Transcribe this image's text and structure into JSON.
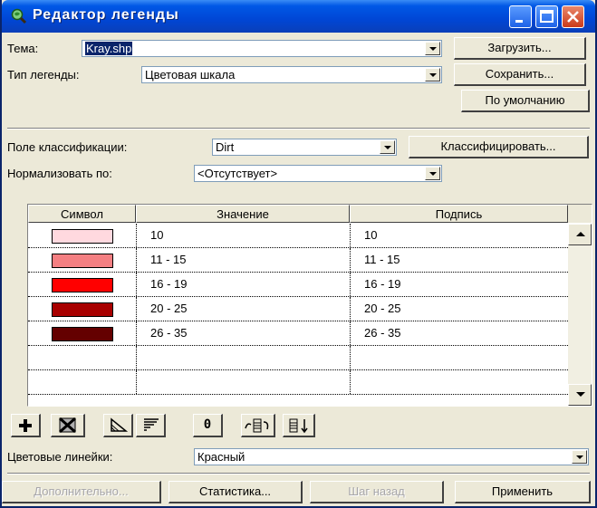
{
  "window": {
    "title": "Редактор легенды"
  },
  "theme": {
    "label": "Тема:",
    "value": "Kray.shp"
  },
  "legend_type": {
    "label": "Тип легенды:",
    "value": "Цветовая шкала"
  },
  "buttons": {
    "load": "Загрузить...",
    "save": "Сохранить...",
    "default": "По умолчанию",
    "classify": "Классифицировать...",
    "advanced": "Дополнительно...",
    "statistics": "Статистика...",
    "undo": "Шаг назад",
    "apply": "Применить"
  },
  "classification_field": {
    "label": "Поле классификации:",
    "value": "Dirt"
  },
  "normalize_by": {
    "label": "Нормализовать по:",
    "value": "<Отсутствует>"
  },
  "table": {
    "headers": {
      "symbol": "Символ",
      "value": "Значение",
      "caption": "Подпись"
    },
    "rows": [
      {
        "color": "#ffd9df",
        "value": "10",
        "caption": "10"
      },
      {
        "color": "#f47f82",
        "value": "11 - 15",
        "caption": "11 - 15"
      },
      {
        "color": "#ff0000",
        "value": "16 - 19",
        "caption": "16 - 19"
      },
      {
        "color": "#a80000",
        "value": "20 - 25",
        "caption": "20 - 25"
      },
      {
        "color": "#640000",
        "value": "26 - 35",
        "caption": "26 - 35"
      }
    ]
  },
  "toolbar": {
    "zero_label": "0"
  },
  "color_ramp": {
    "label": "Цветовые линейки:",
    "value": "Красный"
  }
}
